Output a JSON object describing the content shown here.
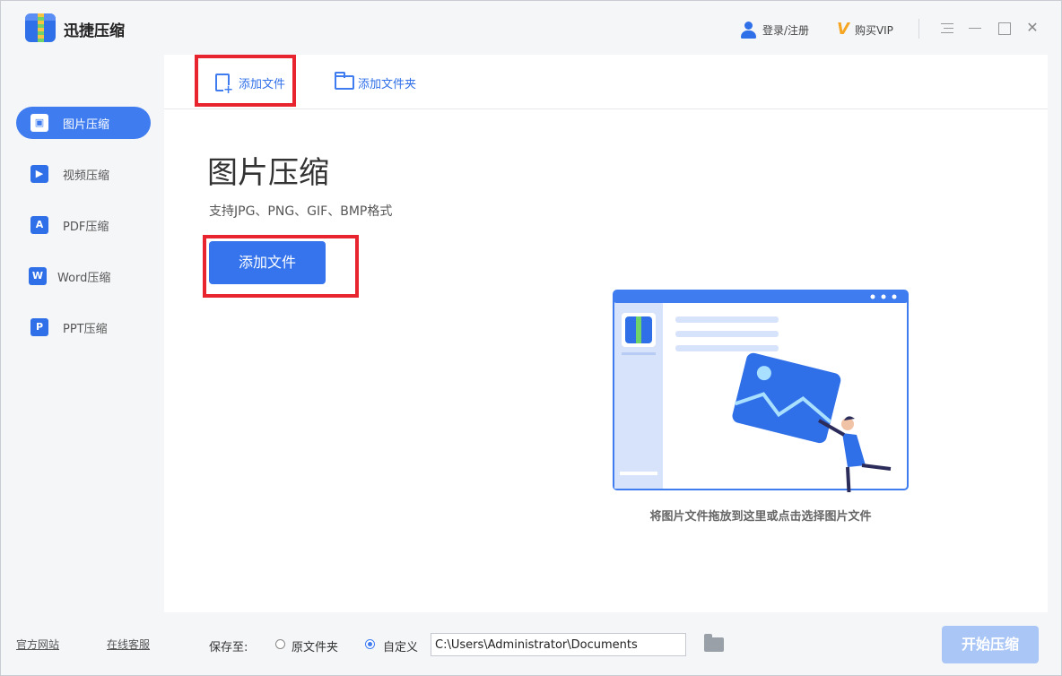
{
  "app": {
    "title": "迅捷压缩"
  },
  "header": {
    "login_label": "登录/注册",
    "vip_label": "购买VIP"
  },
  "sidebar": {
    "items": [
      {
        "label": "图片压缩",
        "icon": "image-icon",
        "active": true
      },
      {
        "label": "视频压缩",
        "icon": "video-icon",
        "active": false
      },
      {
        "label": "PDF压缩",
        "icon": "pdf-icon",
        "active": false
      },
      {
        "label": "Word压缩",
        "icon": "word-icon",
        "active": false
      },
      {
        "label": "PPT压缩",
        "icon": "ppt-icon",
        "active": false
      }
    ],
    "links": {
      "official_site": "官方网站",
      "online_service": "在线客服"
    }
  },
  "toolbar": {
    "add_file_label": "添加文件",
    "add_folder_label": "添加文件夹"
  },
  "main": {
    "title": "图片压缩",
    "subtitle": "支持JPG、PNG、GIF、BMP格式",
    "add_button_label": "添加文件",
    "drop_hint": "将图片文件拖放到这里或点击选择图片文件"
  },
  "bottom": {
    "save_to_label": "保存至:",
    "radio_original": "原文件夹",
    "radio_custom": "自定义",
    "selected": "custom",
    "path_value": "C:\\Users\\Administrator\\Documents",
    "start_label": "开始压缩"
  },
  "colors": {
    "accent": "#3574ed",
    "highlight_box": "#e8252f",
    "disabled_button": "#a9c6f6"
  }
}
